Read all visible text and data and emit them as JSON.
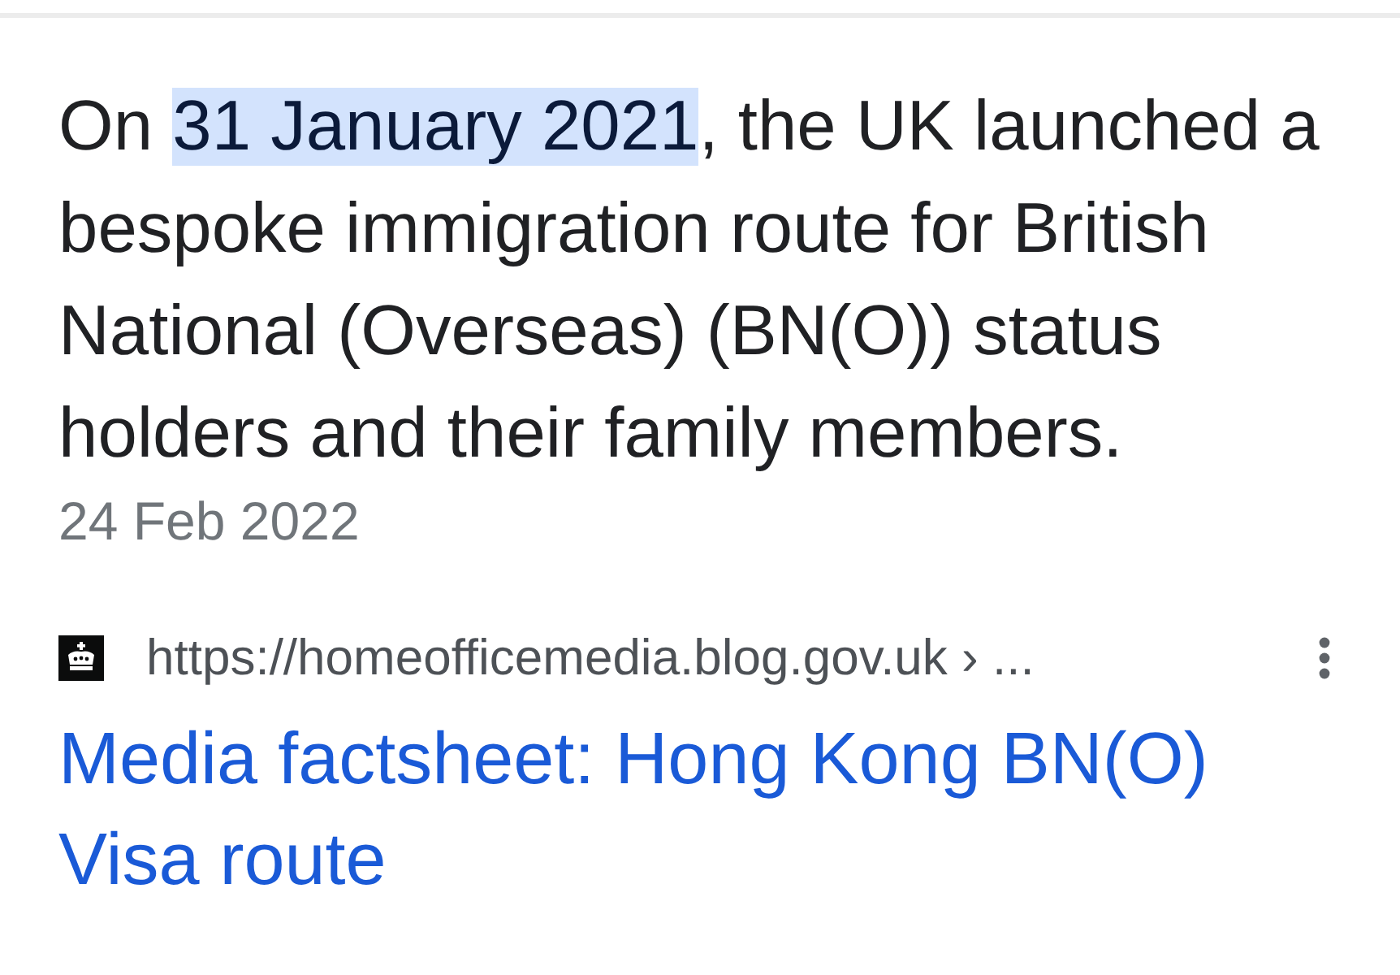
{
  "result": {
    "snippet": "On **31 January 2021**, the UK launched a bespoke immigration route for British National (Overseas) (BN(O)) status holders and their family members.",
    "date": "24 Feb 2022",
    "source": {
      "url": "https://homeofficemedia.blog.gov.uk › ..."
    },
    "title": "Media factsheet: Hong Kong BN(O) Visa route"
  }
}
